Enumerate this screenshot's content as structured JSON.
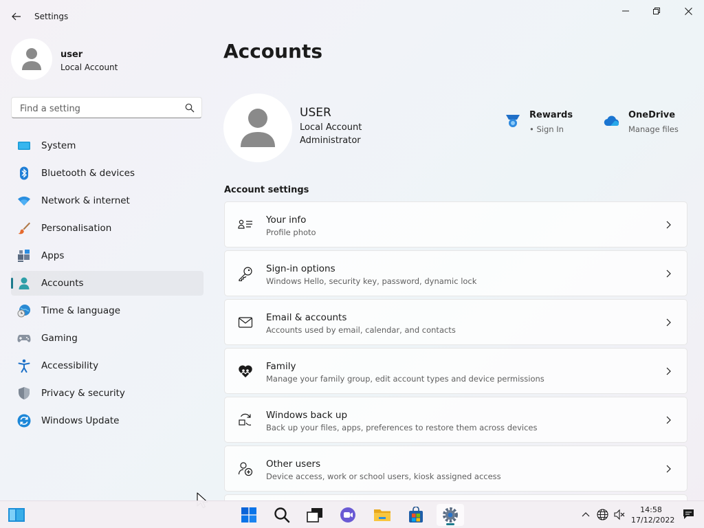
{
  "window": {
    "title": "Settings"
  },
  "profile": {
    "name": "user",
    "account_type": "Local Account"
  },
  "search": {
    "placeholder": "Find a setting"
  },
  "sidebar": {
    "items": [
      {
        "label": "System",
        "icon": "monitor-icon"
      },
      {
        "label": "Bluetooth & devices",
        "icon": "bluetooth-icon"
      },
      {
        "label": "Network & internet",
        "icon": "wifi-icon"
      },
      {
        "label": "Personalisation",
        "icon": "paintbrush-icon"
      },
      {
        "label": "Apps",
        "icon": "apps-icon"
      },
      {
        "label": "Accounts",
        "icon": "person-icon",
        "active": true
      },
      {
        "label": "Time & language",
        "icon": "globe-clock-icon"
      },
      {
        "label": "Gaming",
        "icon": "gamepad-icon"
      },
      {
        "label": "Accessibility",
        "icon": "accessibility-icon"
      },
      {
        "label": "Privacy & security",
        "icon": "shield-icon"
      },
      {
        "label": "Windows Update",
        "icon": "update-icon"
      }
    ]
  },
  "main": {
    "page_title": "Accounts",
    "user": {
      "name": "USER",
      "line1": "Local Account",
      "line2": "Administrator"
    },
    "tiles": {
      "rewards": {
        "title": "Rewards",
        "subtitle": "Sign In"
      },
      "onedrive": {
        "title": "OneDrive",
        "subtitle": "Manage files"
      }
    },
    "section_title": "Account settings",
    "cards": [
      {
        "title": "Your info",
        "subtitle": "Profile photo"
      },
      {
        "title": "Sign-in options",
        "subtitle": "Windows Hello, security key, password, dynamic lock"
      },
      {
        "title": "Email & accounts",
        "subtitle": "Accounts used by email, calendar, and contacts"
      },
      {
        "title": "Family",
        "subtitle": "Manage your family group, edit account types and device permissions"
      },
      {
        "title": "Windows back up",
        "subtitle": "Back up your files, apps, preferences to restore them across devices"
      },
      {
        "title": "Other users",
        "subtitle": "Device access, work or school users, kiosk assigned access"
      }
    ]
  },
  "taskbar": {
    "time": "14:58",
    "date": "17/12/2022"
  },
  "colors": {
    "accent": "#1c7a8c",
    "windows_blue": "#0a64d8"
  }
}
